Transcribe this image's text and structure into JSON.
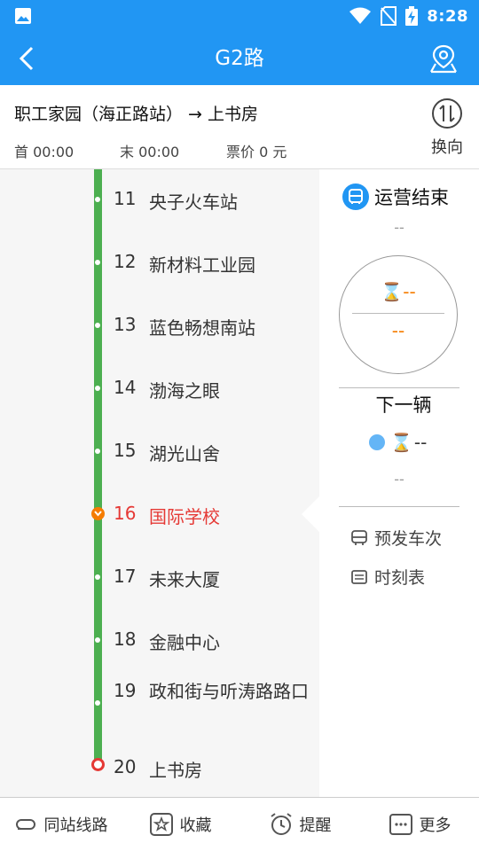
{
  "status_bar": {
    "time": "8:28"
  },
  "app_bar": {
    "title": "G2路"
  },
  "route": {
    "direction": "职工家园（海正路站） → 上书房",
    "first_bus": "首 00:00",
    "last_bus": "末 00:00",
    "fare": "票价 0 元",
    "swap_label": "换向"
  },
  "stops": [
    {
      "num": "11",
      "name": "央子火车站"
    },
    {
      "num": "12",
      "name": "新材料工业园"
    },
    {
      "num": "13",
      "name": "蓝色畅想南站"
    },
    {
      "num": "14",
      "name": "渤海之眼"
    },
    {
      "num": "15",
      "name": "湖光山舍"
    },
    {
      "num": "16",
      "name": "国际学校"
    },
    {
      "num": "17",
      "name": "未来大厦"
    },
    {
      "num": "18",
      "name": "金融中心"
    },
    {
      "num": "19",
      "name": "政和街与听涛路路口"
    },
    {
      "num": "20",
      "name": "上书房"
    }
  ],
  "panel": {
    "status": "运营结束",
    "status_sub": "--",
    "eta_top": "⌛--",
    "eta_bottom": "--",
    "next_title": "下一辆",
    "next_eta": "--",
    "next_sub": "--",
    "scheduled_label": "预发车次",
    "timetable_label": "时刻表"
  },
  "tabs": {
    "same_station": "同站线路",
    "favorite": "收藏",
    "reminder": "提醒",
    "more": "更多"
  },
  "colors": {
    "primary": "#2196f3",
    "route_line": "#4caf50",
    "current_stop": "#e53935",
    "eta": "#f57c00"
  }
}
